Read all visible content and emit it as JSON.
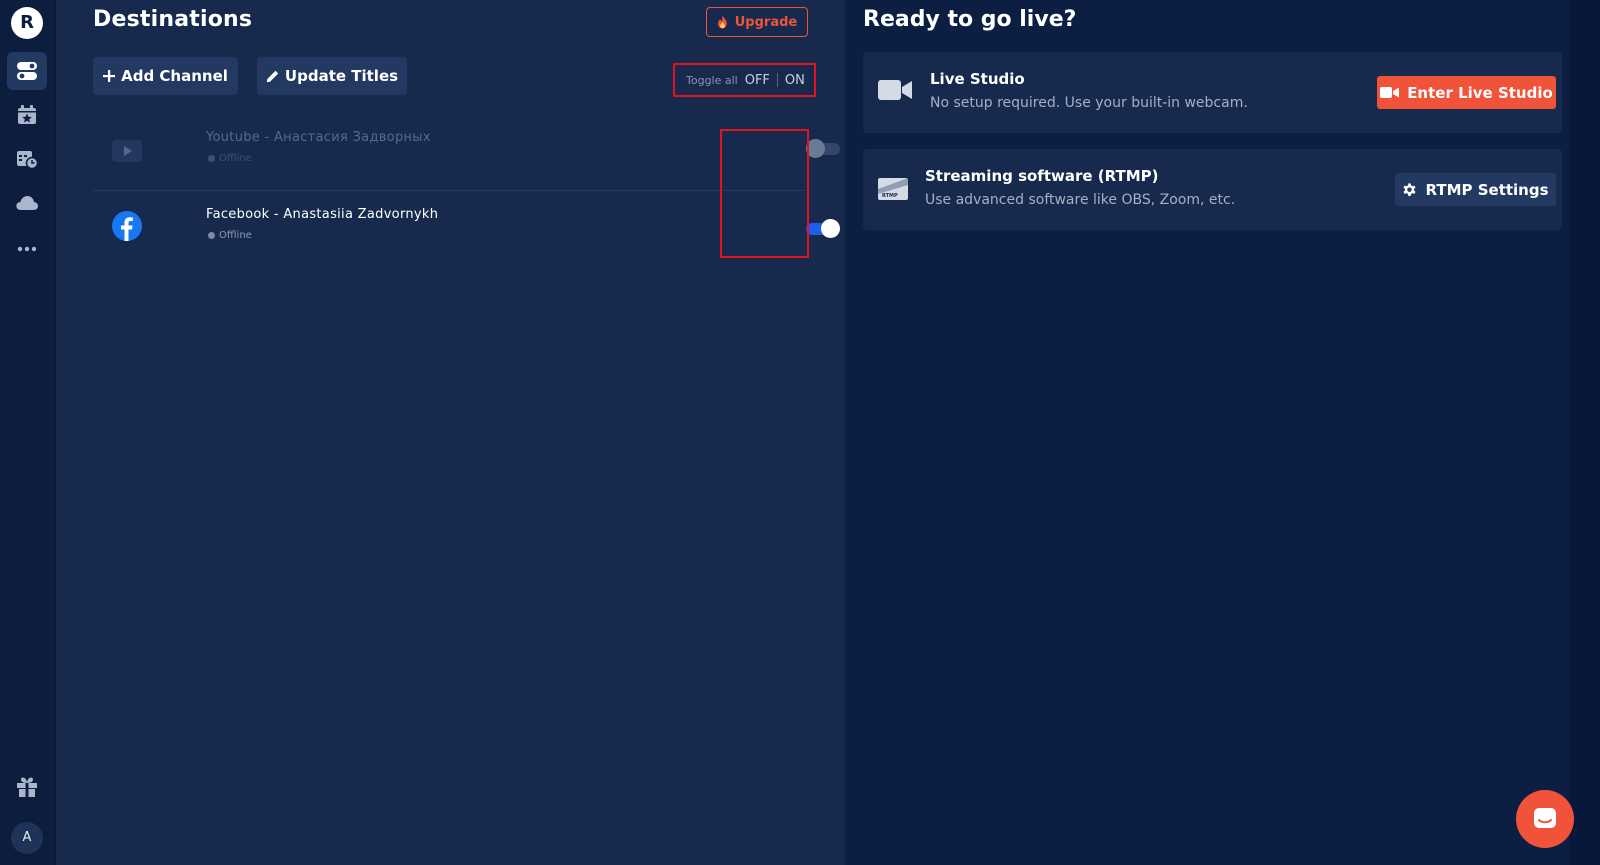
{
  "sidebar": {
    "logo": "R",
    "avatar": "A",
    "items": [
      {
        "name": "destinations",
        "icon": "toggles-icon",
        "active": true
      },
      {
        "name": "events",
        "icon": "calendar-star-icon",
        "active": false
      },
      {
        "name": "schedule",
        "icon": "schedule-icon",
        "active": false
      },
      {
        "name": "cloud",
        "icon": "cloud-icon",
        "active": false
      },
      {
        "name": "more",
        "icon": "more-icon",
        "active": false
      },
      {
        "name": "gift",
        "icon": "gift-icon",
        "active": false
      }
    ]
  },
  "destinations": {
    "title": "Destinations",
    "upgrade_label": "Upgrade",
    "add_channel_label": "Add Channel",
    "update_titles_label": "Update Titles",
    "toggle_all": {
      "label": "Toggle all",
      "off_label": "OFF",
      "on_label": "ON"
    },
    "channels": [
      {
        "platform": "youtube",
        "name": "Youtube - Анастасия Задворных",
        "status": "Offline",
        "enabled": false
      },
      {
        "platform": "facebook",
        "name": "Facebook - Anastasiia Zadvornykh",
        "status": "Offline",
        "enabled": true
      }
    ]
  },
  "live": {
    "title": "Ready to go live?",
    "studio": {
      "title": "Live Studio",
      "subtitle": "No setup required. Use your built-in webcam.",
      "button_label": "Enter Live Studio"
    },
    "rtmp": {
      "icon_text": "RTMP",
      "title": "Streaming software (RTMP)",
      "subtitle": "Use advanced software like OBS, Zoom, etc.",
      "button_label": "RTMP Settings"
    }
  },
  "colors": {
    "accent": "#f0533a",
    "toggle_on": "#1f5ee6",
    "highlight_box": "#e0141e",
    "facebook": "#1877f2"
  }
}
